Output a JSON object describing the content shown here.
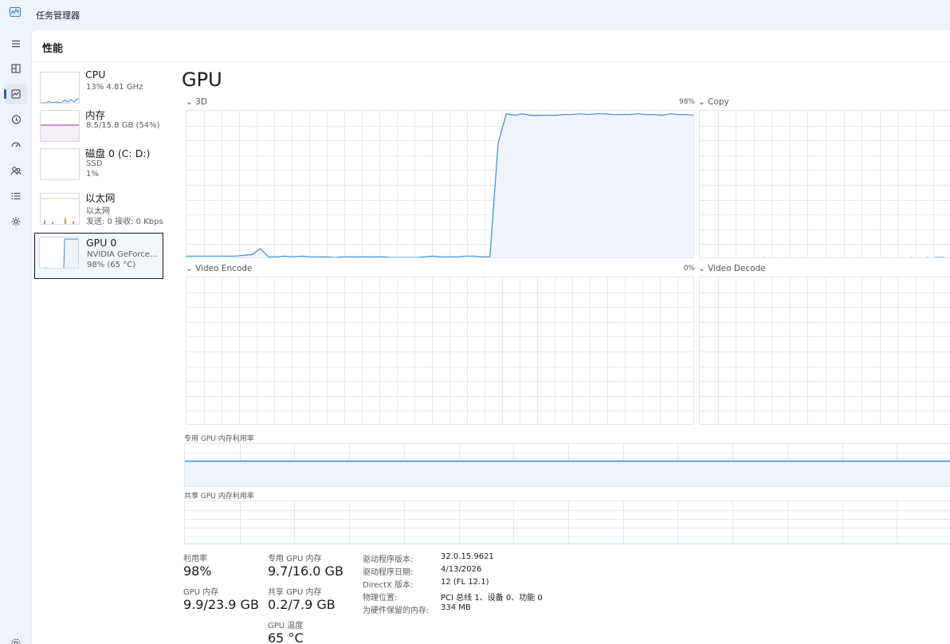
{
  "app": {
    "title": "任务管理器"
  },
  "colors": {
    "accent": "#1f5fb3",
    "gpu_line": "#3a8fd0",
    "gpu_fill": "#eef4fa",
    "mem_line": "#8b3d8f",
    "net_line": "#c58a4a",
    "grid": "#e6e9ed"
  },
  "nav": [
    {
      "name": "hamburger-icon",
      "label": "menu"
    },
    {
      "name": "processes-icon",
      "label": "processes"
    },
    {
      "name": "performance-icon",
      "label": "performance",
      "active": true
    },
    {
      "name": "app-history-icon",
      "label": "app history"
    },
    {
      "name": "startup-apps-icon",
      "label": "startup apps"
    },
    {
      "name": "users-icon",
      "label": "users"
    },
    {
      "name": "details-icon",
      "label": "details"
    },
    {
      "name": "services-icon",
      "label": "services"
    },
    {
      "name": "settings-icon",
      "label": "settings"
    }
  ],
  "page": {
    "title": "性能"
  },
  "devices": [
    {
      "name": "CPU",
      "sub1": "13% 4.81 GHz",
      "sub2": ""
    },
    {
      "name": "内存",
      "sub1": "8.5/15.8 GB (54%)",
      "sub2": ""
    },
    {
      "name": "磁盘 0 (C: D:)",
      "sub1": "SSD",
      "sub2": "1%"
    },
    {
      "name": "以太网",
      "sub1": "以太网",
      "sub2": "发送: 0 接收: 0 Kbps"
    },
    {
      "name": "GPU 0",
      "sub1": "NVIDIA GeForce...",
      "sub2": "98% (65 °C)",
      "selected": true
    }
  ],
  "gpu": {
    "title": "GPU",
    "engines": [
      {
        "label": "3D",
        "max_label": "98%"
      },
      {
        "label": "Copy",
        "max_label": ""
      },
      {
        "label": "Video Encode",
        "max_label": "0%"
      },
      {
        "label": "Video Decode",
        "max_label": ""
      }
    ],
    "series_3d": [
      2,
      2,
      2,
      2,
      2,
      2,
      2,
      2.5,
      3,
      7,
      1.5,
      1.5,
      2,
      1.5,
      2,
      1.5,
      1.5,
      1.5,
      1,
      1.5,
      1.5,
      1.5,
      1.5,
      1.5,
      1.5,
      1,
      1,
      1,
      1,
      1.5,
      2,
      1.5,
      1.5,
      1.5,
      2,
      2,
      1.5,
      1.5,
      78,
      98,
      97,
      98,
      97,
      97,
      97,
      97,
      97.5,
      97.5,
      98,
      97.5,
      98,
      98,
      97.5,
      97.5,
      97.5,
      98,
      97.5,
      97.5,
      97,
      98,
      97.5,
      97.5,
      97
    ],
    "series_copy": [
      0,
      0,
      0,
      0,
      0,
      0,
      0,
      0,
      0,
      0,
      0,
      0,
      0,
      0,
      0,
      0.5,
      1,
      0.5,
      0,
      0,
      0,
      0,
      0,
      0,
      0,
      0,
      0,
      0,
      0,
      0,
      0,
      0,
      0,
      0,
      0,
      0,
      0,
      0,
      0,
      0,
      0,
      0,
      0,
      0,
      0,
      0,
      0,
      0,
      0,
      0,
      0,
      0.5,
      1,
      0.5,
      0,
      0.5,
      1,
      0.5,
      1,
      1,
      1,
      0.5,
      0
    ],
    "dedicated_label": "专用 GPU 内存利用率",
    "shared_label": "共享 GPU 内存利用率",
    "dedicated_level": 0.606,
    "shared_level": 0.025,
    "stats": {
      "util_label": "利用率",
      "util_value": "98%",
      "dedicated_label": "专用 GPU 内存",
      "dedicated_value": "9.7/16.0 GB",
      "gpu_mem_label": "GPU 内存",
      "gpu_mem_value": "9.9/23.9 GB",
      "shared_label": "共享 GPU 内存",
      "shared_value": "0.2/7.9 GB",
      "temp_label": "GPU 温度",
      "temp_value": "65 °C"
    },
    "info": [
      {
        "k": "驱动程序版本:",
        "v": "32.0.15.9621"
      },
      {
        "k": "驱动程序日期:",
        "v": "4/13/2026"
      },
      {
        "k": "DirectX 版本:",
        "v": "12 (FL 12.1)"
      },
      {
        "k": "物理位置:",
        "v": "PCI 总线 1、设备 0、功能 0"
      },
      {
        "k": "为硬件保留的内存:",
        "v": "334 MB"
      }
    ]
  }
}
